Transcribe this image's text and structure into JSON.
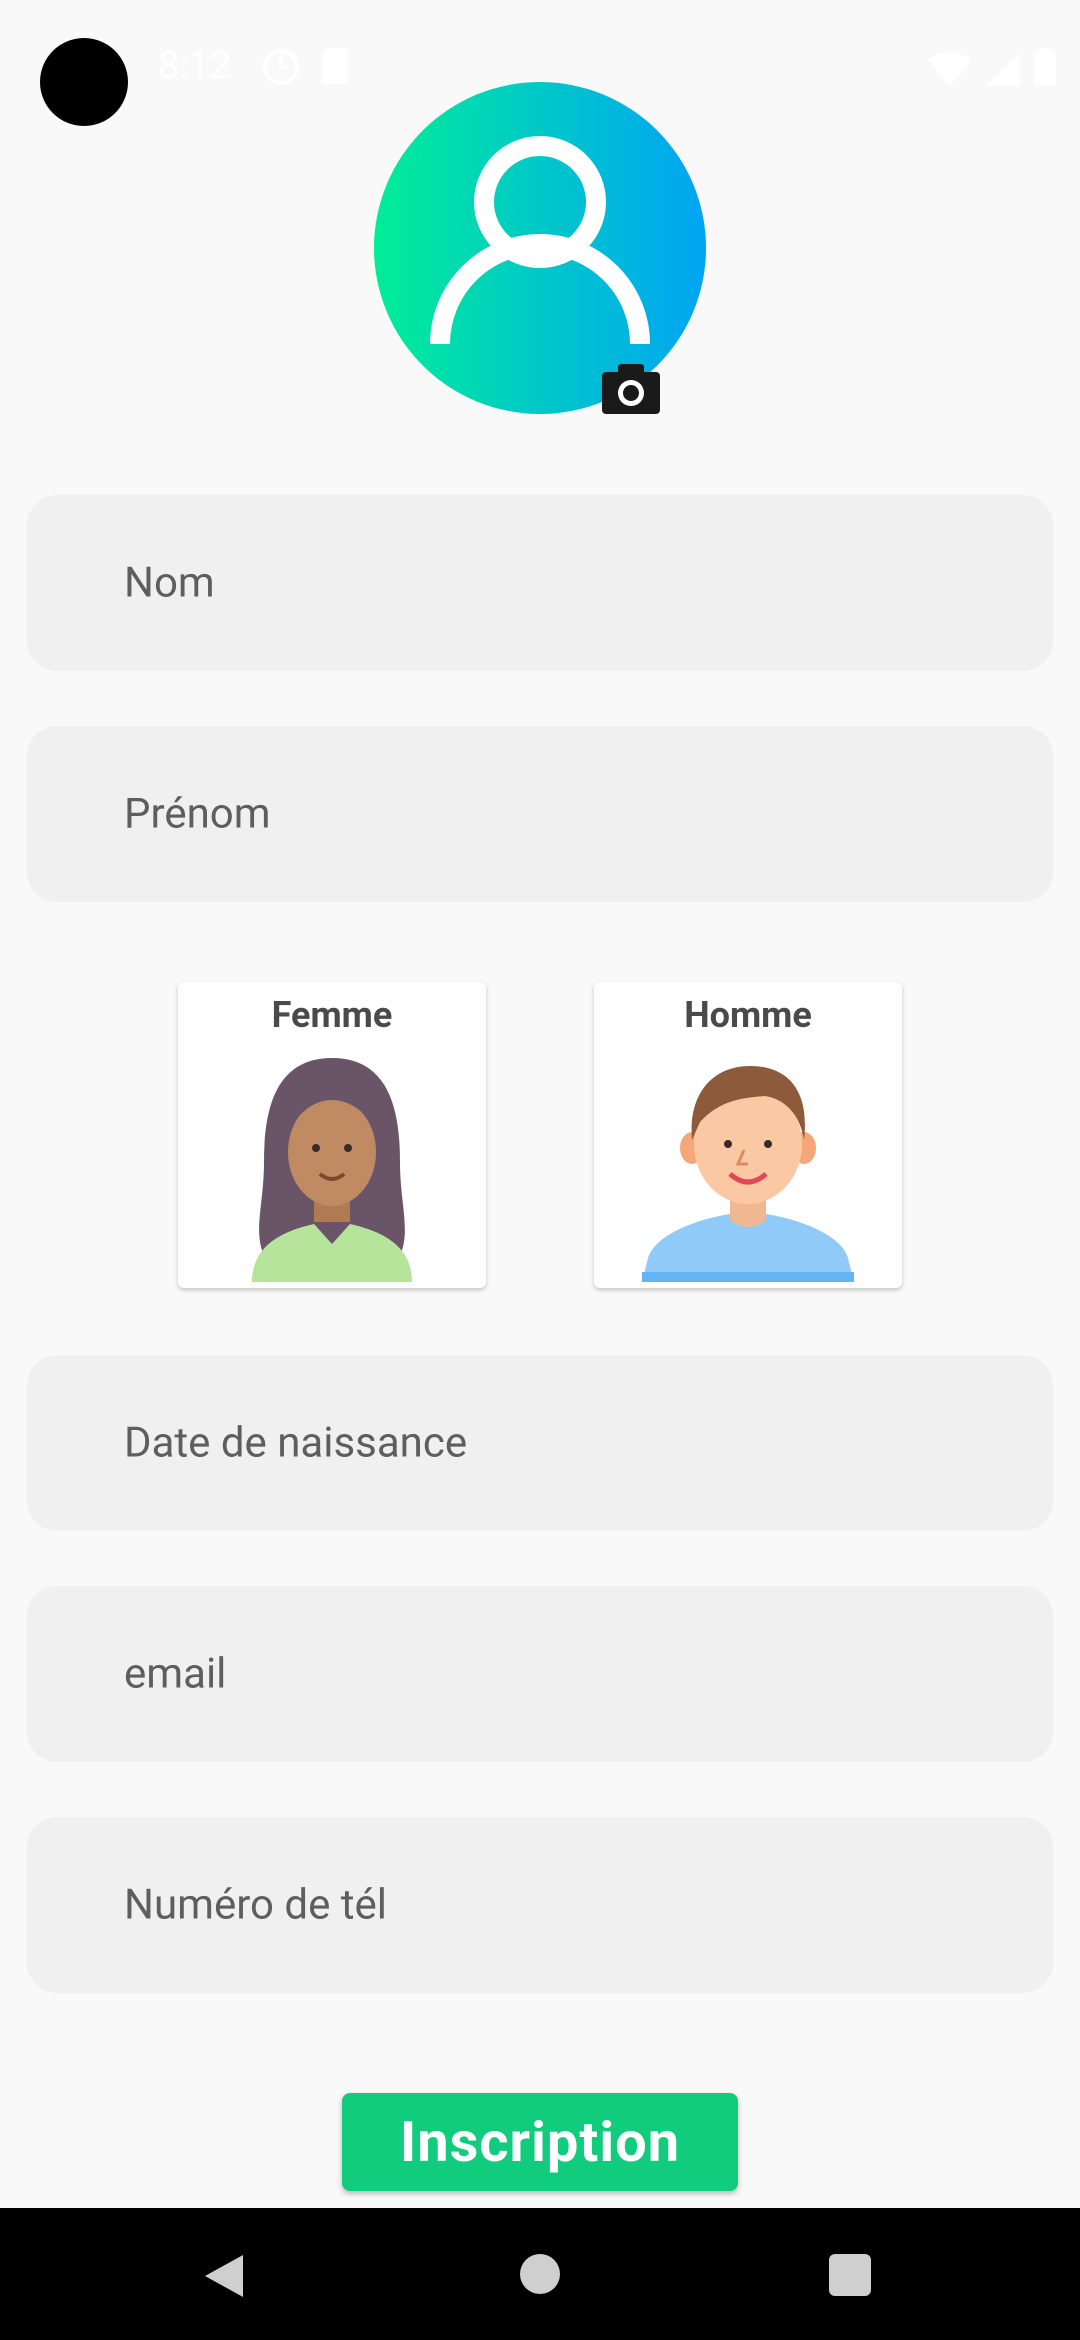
{
  "status_bar": {
    "time": "8:12",
    "icons": [
      "sync-icon",
      "sd-card-icon",
      "wifi-icon",
      "signal-icon",
      "battery-icon"
    ]
  },
  "avatar": {
    "icon": "person-icon",
    "badge_icon": "camera-icon"
  },
  "fields": {
    "nom": "Nom",
    "prenom": "Prénom",
    "date": "Date de naissance",
    "email": "email",
    "phone": "Numéro de tél"
  },
  "gender": {
    "female_label": "Femme",
    "male_label": "Homme"
  },
  "submit_label": "Inscription",
  "colors": {
    "accent_green": "#11cc7c",
    "avatar_gradient_start": "#00ee96",
    "avatar_gradient_end": "#00a4f4",
    "field_bg": "#f0f0f0"
  }
}
